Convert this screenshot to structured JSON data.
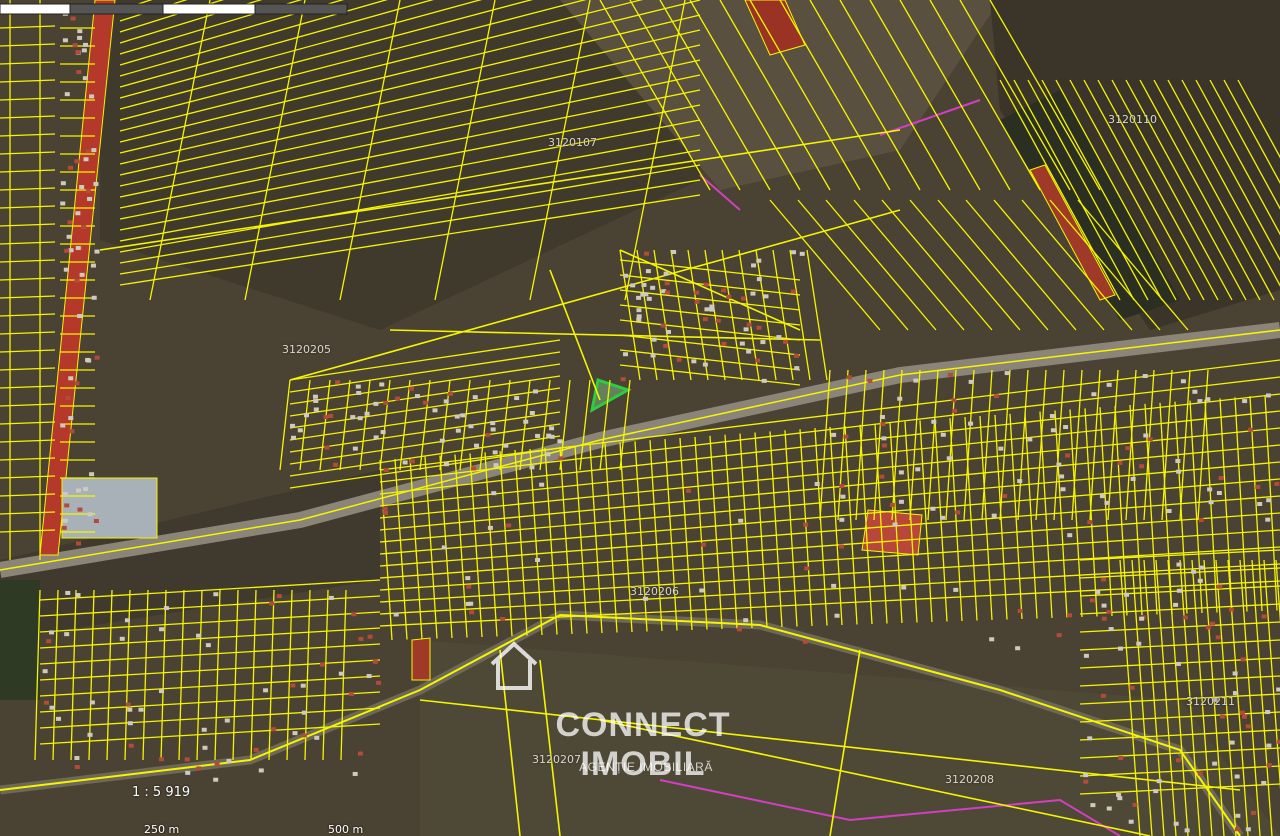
{
  "map": {
    "sectors": [
      {
        "id": "s1",
        "label": "3120107"
      },
      {
        "id": "s2",
        "label": "3120110"
      },
      {
        "id": "s3",
        "label": "3120205"
      },
      {
        "id": "s4",
        "label": "3120206"
      },
      {
        "id": "s5",
        "label": "3120207"
      },
      {
        "id": "s6",
        "label": "3120208"
      },
      {
        "id": "s7",
        "label": "3120211"
      }
    ],
    "colors": {
      "parcel_border": "#f5f500",
      "highlight_parcel": "#2ecc40",
      "road_red": "#c0392b",
      "boundary_magenta": "#d040c0",
      "ground": "#4a4232"
    }
  },
  "watermark": {
    "brand": "CONNECT IMOBIL",
    "tagline": "AGENȚIE IMOBILIARĂ",
    "icon": "house-icon"
  },
  "scale": {
    "ratio": "1 : 5 919",
    "tick_250": "250 m",
    "tick_500": "500 m"
  }
}
